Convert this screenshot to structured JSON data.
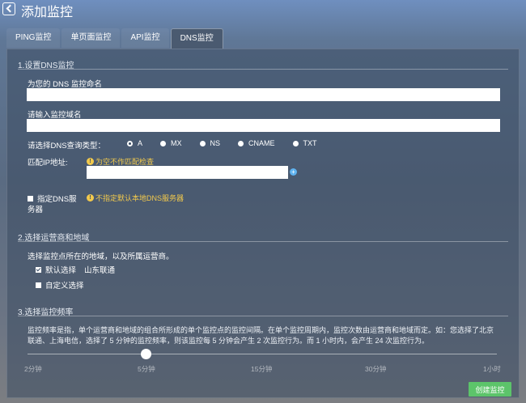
{
  "header": {
    "title": "添加监控"
  },
  "tabs": [
    {
      "label": "PING监控"
    },
    {
      "label": "单页面监控"
    },
    {
      "label": "API监控"
    },
    {
      "label": "DNS监控"
    }
  ],
  "section1": {
    "title": "1.设置DNS监控",
    "name_label": "为您的 DNS 监控命名",
    "name_value": "",
    "domain_label": "请输入监控域名",
    "domain_value": "",
    "query_type_label": "请选择DNS查询类型：",
    "query_types": [
      "A",
      "MX",
      "NS",
      "CNAME",
      "TXT"
    ],
    "query_type_selected": "A",
    "match_ip_label": "匹配IP地址:",
    "match_ip_hint": "为空不作匹配检查",
    "match_ip_value": "",
    "specify_dns_label_1": "指定DNS服",
    "specify_dns_label_2": "务器",
    "specify_dns_hint": "不指定默认本地DNS服务器"
  },
  "section2": {
    "title": "2.选择运营商和地域",
    "desc": "选择监控点所在的地域，以及所属运营商。",
    "default_label": "默认选择",
    "default_value": "山东联通",
    "custom_label": "自定义选择"
  },
  "section3": {
    "title": "3.选择监控频率",
    "desc": "监控频率是指，单个运营商和地域的组合所形成的单个监控点的监控间隔。在单个监控周期内，监控次数由运营商和地域而定。如：您选择了北京联通、上海电信，选择了 5 分钟的监控频率，则该监控每 5 分钟会产生 2 次监控行为。而 1 小时内，会产生 24 次监控行为。",
    "ticks": [
      "2分钟",
      "5分钟",
      "15分钟",
      "30分钟",
      "1小时"
    ],
    "selected": "5分钟"
  },
  "actions": {
    "create_label": "创建监控"
  },
  "colors": {
    "accent_green": "#5cc46a",
    "hint_yellow": "#f2c94c",
    "plus_blue": "#5fb3f0"
  }
}
